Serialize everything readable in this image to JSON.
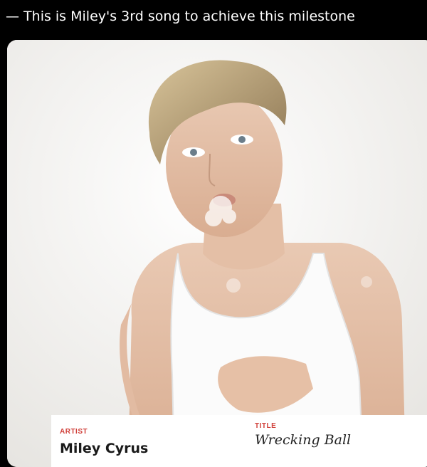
{
  "caption": {
    "text": "— This is Miley's 3rd song to achieve this milestone"
  },
  "card": {
    "artist_label": "ARTIST",
    "artist_name": "Miley Cyrus",
    "title_label": "TITLE",
    "song_title": "Wrecking Ball"
  },
  "colors": {
    "label_red": "#d0403a",
    "background": "#000000",
    "card_bg": "#f3f1ee"
  }
}
